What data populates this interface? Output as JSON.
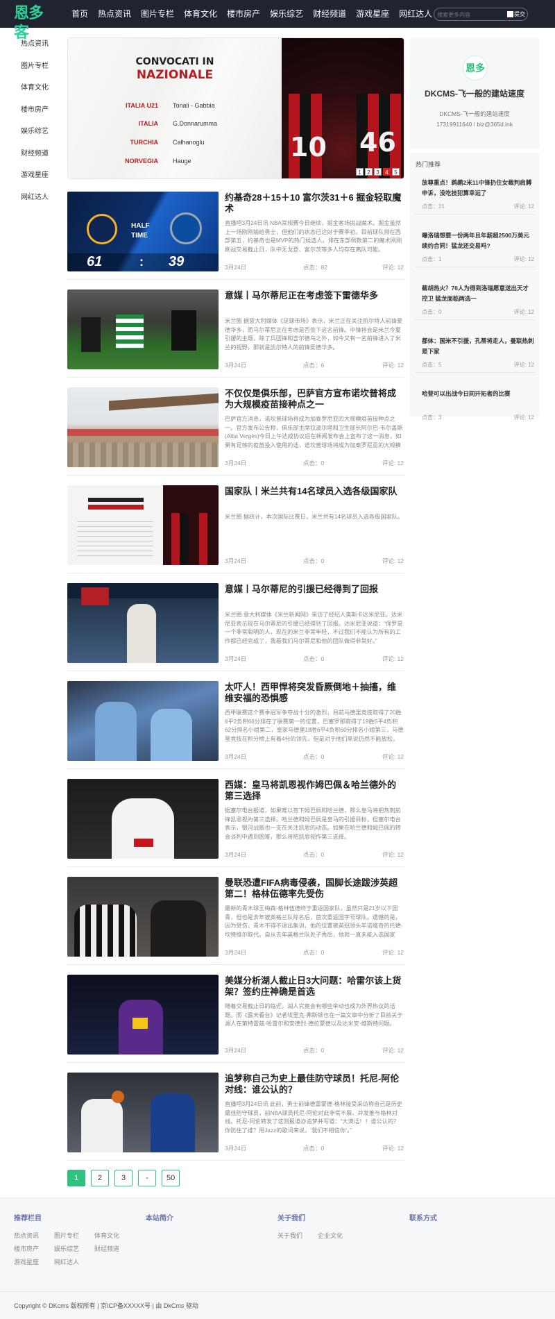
{
  "header": {
    "logo_text": "恩多客",
    "nav": [
      "首页",
      "热点资讯",
      "图片专栏",
      "体育文化",
      "楼市房产",
      "娱乐综艺",
      "财经频道",
      "游戏星座",
      "网红达人"
    ],
    "search_placeholder": "搜索更多内容",
    "search_button": "提交"
  },
  "left_sidebar": [
    "热点资讯",
    "图片专栏",
    "体育文化",
    "楼市房产",
    "娱乐综艺",
    "财经频道",
    "游戏星座",
    "网红达人"
  ],
  "banner": {
    "title_line1": "CONVOCATI IN",
    "title_line2": "NAZIONALE",
    "rows": [
      {
        "team": "ITALIA U21",
        "players": "Tonali - Gabbia"
      },
      {
        "team": "ITALIA",
        "players": "G.Donnarumma"
      },
      {
        "team": "TURCHIA",
        "players": "Calhanoglu"
      },
      {
        "team": "NORVEGIA",
        "players": "Hauge"
      }
    ],
    "jersey_numbers": [
      "10",
      "46"
    ],
    "slides": [
      "1",
      "2",
      "3",
      "4",
      "5"
    ],
    "active_slide": 4
  },
  "articles": [
    {
      "title": "约基奇28＋15＋10 富尔茨31＋6 掘金轻取魔术",
      "summary": "直播吧3月24日讯 NBA常规赛今日继续，掘金客场挑战魔术。掘金虽然上一场刚刚输给勇士，但他们的状态已达好于赛季初。目前球队排在西部第五，约基奇也是MVP的热门候选人。排在东部倒数第二的魔术刚刚刷战交易截止日，队中无戈登、富尔茨等多人均存在离队可能。",
      "date": "3月24日",
      "clicks": "点击：82",
      "comments": "评论: 12",
      "thumb": "nba"
    },
    {
      "title": "意媒丨马尔蒂尼正在考虑签下雷德华多",
      "summary": "米兰圈 据意大利媒体《足球市场》表示，米兰正在关注凯尔特人前锋爱德华多，而马尔蒂尼正在考虑是否签下这名前锋。中锋将会是米兰今夏引援的主题，除了兵团锋和吉尔德乌之外，如今又有一名前锋进入了米兰的视野，那就是凯尔特人的前锋爱德华多。",
      "date": "3月24日",
      "clicks": "点击：6",
      "comments": "评论: 12",
      "thumb": "celtic"
    },
    {
      "title": "不仅仅是俱乐部，巴萨官方宣布诺坎普将成为大规模疫苗接种点之一",
      "summary": "巴萨官方消息，诺坎普球场将成为加泰罗尼亚的大规模疫苗接种点之一。官方发布公告称，俱乐部主席拉波尔塔和卫生部长阿尔巴-韦尔盖斯(Alba Vergés)今日上午达成协议后在新闻发布会上宣布了这一消息，如果有足够的疫苗投入使用的话，诺坎普球场将成为加泰罗尼亚的大规模接种点之一。",
      "date": "3月24日",
      "clicks": "点击：0",
      "comments": "评论: 12",
      "thumb": "stadium"
    },
    {
      "title": "国家队丨米兰共有14名球员入选各级国家队",
      "summary": "米兰圈 据统计，本次国际比赛日，米兰共有14名球员入选各级国家队。",
      "date": "3月24日",
      "clicks": "点击：0",
      "comments": "评论: 12",
      "thumb": "convocati"
    },
    {
      "title": "意媒丨马尔蒂尼的引援已经得到了回报",
      "summary": "米兰圈 意大利媒体《米兰新闻网》采访了经纪人奥斯卡达米尼亚。达米尼亚表示现在马尔蒂尼的引援已经得到了回报。达米尼亚说道：“保罗是一个非常聪明的人，现在的米兰非常年轻，不过我们不能认为所有的工作都已经完成了，我看我们马尔蒂尼和他的团队做得非常好。”",
      "date": "3月24日",
      "clicks": "点击：0",
      "comments": "评论: 12",
      "thumb": "maldini"
    },
    {
      "title": "太吓人！西甲悍将突发昏厥倒地＋抽搐，维维安福的恐惧感",
      "summary": "西甲联赛这个赛季冠军争夺战十分的激烈，目前马德里竞技取得了20胜6平2负积66分排在了联赛第一的位置，巴塞罗那取得了19胜5平4负积62分排名小组第二，皇家马德里18胜6平4负积60分排名小组第三，马德里竞技在积分榜上有着4分的领先，但是对于他们来说仍然不能放松。",
      "date": "3月24日",
      "clicks": "点击：0",
      "comments": "评论: 12",
      "thumb": "crowd"
    },
    {
      "title": "西媒：皇马将凯恩视作姆巴佩＆哈兰德外的第三选择",
      "summary": "据塞尔电台报道，如果难以签下姆巴佩和哈兰德，那么皇马将把热刺前锋凯恩视为第三选择。哈兰德和姆巴佩是皇马的引援目标，但塞尔电台表示，银河战舰也一支在关注凯恩的动态。如果在哈兰德和姆巴佩的转会谈判中遇到困难，那么将把凯恩视作第三选择。",
      "date": "3月24日",
      "clicks": "点击：0",
      "comments": "评论: 12",
      "thumb": "kane"
    },
    {
      "title": "曼联恐遭FIFA病毒侵袭，国脚长途跋涉英超第二！格林伍德率先受伤",
      "summary": "最新的青木球王梅森·格林伍德终于重返国家队，虽然只是21岁以下国青，但也是去年被英格兰队除名后，首次重返国字号球队。遗憾的是，因为受伤，青木不得不退出集训，他的位置被英冠领头羊诺维奇的托德·坎特维尔取代。自从去年英格兰队处子秀后，他就一直未能入选国家队。",
      "date": "3月24日",
      "clicks": "点击：0",
      "comments": "评论: 12",
      "thumb": "manutd"
    },
    {
      "title": "美媒分析湖人截止日3大问题：哈雷尔该上货架？签约庄神确是首选",
      "summary": "随着交易截止日的临近，湖人究竟会有哪些举动也成为外界热议的话题。而《露天看台》记者埃里克-弗斯顿也在一篇文章中分析了目前关于湖人在第特雷兹·哈雷尔和安德烈·德拉蒙德以及达米安·维斯特问题。",
      "date": "3月24日",
      "clicks": "点击：0",
      "comments": "评论: 12",
      "thumb": "lakers"
    },
    {
      "title": "追梦称自己为史上最佳防守球员！托尼-阿伦对线：谁公认的？",
      "summary": "直播吧3月24日讯 此前，勇士前锋德雷蒙德-格林接受采访称自己是历史最佳防守球员，前NBA球员托尼-阿伦对此非常不屑，并发推与格林对线。托尼-阿伦转发了这则报道@追梦并写道：“大漠话！！谁公认的？你防住了谁？用Jazz的歌词来说，‘我们不相信你’。”",
      "date": "3月24日",
      "clicks": "点击：0",
      "comments": "评论: 12",
      "thumb": "grizzlies"
    }
  ],
  "nba_thumb": {
    "half": "HALF",
    "time": "TIME",
    "score_left": "61",
    "colon": ":",
    "score_right": "39"
  },
  "pagination": [
    "1",
    "2",
    "3",
    "-",
    "50"
  ],
  "profile": {
    "logo_text": "恩多",
    "name": "DKCMS-飞一般的建站速度",
    "desc": "DKCMS-飞一般的建站速度",
    "contact": "17319911640 / biz@365d.ink"
  },
  "hot": {
    "title": "热门推荐",
    "items": [
      {
        "title": "放尊重点！鹈鹕2米11中锋扔住女裁判肩膊申诉，没吃技犯算幸运了",
        "clicks": "点击：21",
        "comments": "评论: 12"
      },
      {
        "title": "曝洛瑞想要一份两年且年薪超2500万美元续约合同！猛龙还交易吗?",
        "clicks": "点击：1",
        "comments": "评论: 12"
      },
      {
        "title": "截胡热火？76人为得到洛瑞愿意送出天才控卫 猛龙面临两选一",
        "clicks": "点击：0",
        "comments": "评论: 12"
      },
      {
        "title": "都体：国米不引援，孔蒂将走人，曼联热刺是下家",
        "clicks": "点击：5",
        "comments": "评论: 12"
      },
      {
        "title": "哈登可以出战今日同开拓者的比赛",
        "clicks": "点击：3",
        "comments": "评论: 12"
      }
    ]
  },
  "footer": {
    "cols": [
      {
        "heading": "推荐栏目",
        "links": [
          "热点资讯",
          "图片专栏",
          "体育文化",
          "楼市房产",
          "娱乐综艺",
          "财经频道",
          "游戏星座",
          "网红达人"
        ]
      },
      {
        "heading": "本站简介",
        "links": []
      },
      {
        "heading": "关于我们",
        "links": [
          "关于我们",
          "企业文化"
        ]
      },
      {
        "heading": "联系方式",
        "links": []
      }
    ],
    "copyright": "Copyright © DKcms 版权所有 | 京ICP备XXXXX号 | 由 DkCms 驱动"
  },
  "colors": {
    "header_bg": "#1f2430",
    "accent": "#2ec27e",
    "brand_red": "#b21f24"
  }
}
